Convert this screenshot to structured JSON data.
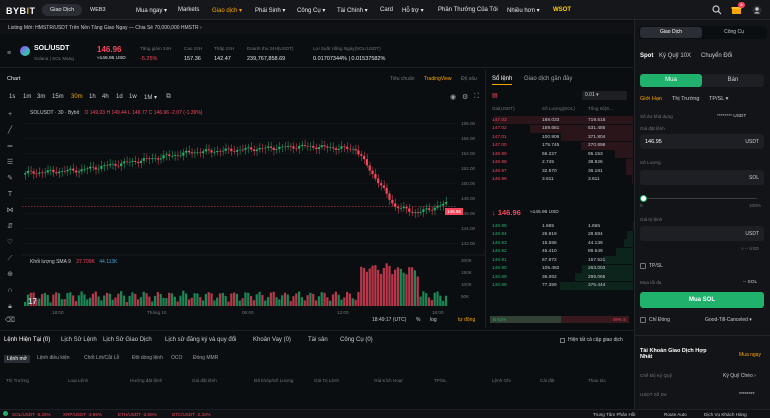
{
  "header": {
    "logo": "BYBIT",
    "seg_left": "Giao Dịch",
    "seg_right": "WEB3",
    "nav": [
      "Mua ngay ▾",
      "Markets",
      "Giao dịch ▾",
      "Phái Sinh ▾",
      "Công Cụ ▾",
      "Tài Chính ▾",
      "Card",
      "Hỗ trợ ▾",
      "Phần Thưởng Của Tôi",
      "Nhiều hơn ▾",
      "WSOT"
    ],
    "notif_count": "8"
  },
  "ticker": {
    "text": "Listing Mới: HMSTR/USDT Trên Nền Tảng Giao Ngay — Chia Sẻ 70,000,000 HMSTR  ›"
  },
  "symbol": {
    "pair": "SOL/USDT",
    "network": "Solana  |  SOL Mạng",
    "price": "146.96",
    "price_usd": "≈146.96 USD",
    "stats": [
      {
        "label": "Tăng giảm 24H",
        "value": "-5.25%",
        "cls": "red"
      },
      {
        "label": "Cao 24H",
        "value": "157.36",
        "cls": ""
      },
      {
        "label": "Thấp 24H",
        "value": "142.47",
        "cls": ""
      },
      {
        "label": "Doanh thu 24H(USDT)",
        "value": "239,767,858.69",
        "cls": ""
      },
      {
        "label": "Lợi Suất Hằng Ngày(SOL/USDT)",
        "value": "0.01707344% | 0.01537582%",
        "cls": "green"
      }
    ]
  },
  "chart": {
    "title": "Chart",
    "views": [
      "Tiêu chuẩn",
      "TradingView",
      "Độ sâu"
    ],
    "active_view": "TradingView",
    "intervals": [
      "1s",
      "1m",
      "3m",
      "15m",
      "30m",
      "1h",
      "4h",
      "1d",
      "1w",
      "1M ▾"
    ],
    "active_interval": "30m",
    "legend": "SOLUSDT · 30 · Bybit",
    "ohlc": "O 149.03  H 149.44  L 146.77  C 146.96  -2.07 (-1.39%)",
    "volume_label": "Khối lượng SMA 9",
    "volume_values": [
      "27.709K",
      "44.113K"
    ],
    "price_tag": "146.96",
    "x_ticks": [
      "18:00",
      "Tháng 10",
      "06:00",
      "12:00",
      "18:00"
    ],
    "time": "18:49:17 (UTC)",
    "scale_opts": [
      "%",
      "log",
      "tự động"
    ],
    "x_labels_bottom": "12:00"
  },
  "chart_data": {
    "type": "bar",
    "y_axis_ticks": [
      "158.00",
      "156.00",
      "154.00",
      "152.00",
      "150.00",
      "148.00",
      "146.00",
      "144.00",
      "142.00"
    ],
    "volume_ticks": [
      "200K",
      "150K",
      "100K",
      "50K"
    ],
    "ylim": [
      141,
      159
    ]
  },
  "orderbook": {
    "tabs": [
      "Sổ lệnh",
      "Giao dịch gần đây"
    ],
    "precision": "0.01",
    "cols": [
      "Giá(USDT)",
      "Số Lượng(SOL)",
      "Tổng số(S..."
    ],
    "asks": [
      [
        "147.03",
        "188.033",
        "719.518"
      ],
      [
        "147.02",
        "159.681",
        "531.485"
      ],
      [
        "147.01",
        "100.906",
        "371.804"
      ],
      [
        "147.00",
        "175.745",
        "270.898"
      ],
      [
        "146.99",
        "56.227",
        "95.153"
      ],
      [
        "146.98",
        "2.745",
        "38.926"
      ],
      [
        "146.97",
        "32.570",
        "36.181"
      ],
      [
        "146.96",
        "3.611",
        "3.611"
      ]
    ],
    "mid": "146.96",
    "mid_usd": "≈146.96 USD",
    "bids": [
      [
        "146.95",
        "1.665",
        "1.665"
      ],
      [
        "146.94",
        "26.919",
        "28.584"
      ],
      [
        "146.93",
        "15.555",
        "44.139"
      ],
      [
        "146.92",
        "45.410",
        "89.549"
      ],
      [
        "146.91",
        "67.972",
        "157.521"
      ],
      [
        "146.90",
        "105.482",
        "263.003"
      ],
      [
        "146.89",
        "36.062",
        "299.065"
      ],
      [
        "146.88",
        "77.359",
        "376.444"
      ]
    ],
    "buy_pct": "51%",
    "sell_pct": "49%",
    "buy_ratio": 0.51
  },
  "order": {
    "tabs": [
      "Giao Dịch",
      "Công Cụ"
    ],
    "mode_tabs": [
      "Spot",
      "Ký Quỹ 10X",
      "Chuyển Đổi"
    ],
    "side": [
      "Mua",
      "Bán"
    ],
    "types": [
      "Giới Hạn",
      "Thị Trường",
      "TP/SL ▾"
    ],
    "available_label": "Số dư khả dụng",
    "available_value": "******** USDT",
    "price_label": "Giá đặt lệnh",
    "price_value": "146.95",
    "price_unit": "USDT",
    "qty_label": "Số Lượng",
    "qty_unit": "SOL",
    "slider_pct": "0",
    "slider_max": "100%",
    "value_label": "Giá trị lệnh",
    "value_unit": "USDT",
    "value_approx": "≈ -- USD",
    "tpsl": "TP/SL",
    "max_buy_label": "Mua tối đa",
    "max_buy_value": "-- SOL",
    "submit": "Mua SOL",
    "post_only": "Chỉ Đóng",
    "tif": "Good-Till-Canceled ▾",
    "acct_title": "Tài Khoản Giao Dịch Hợp Nhất",
    "acct_action": "Mua ngay",
    "margin_label": "Chế Độ Ký Quỹ",
    "margin_value": "Ký Quỹ Chéo ›",
    "equity_label": "USDT Số Dư",
    "equity_value": "********"
  },
  "bottom": {
    "tabs": [
      "Lệnh Hiện Tại (0)",
      "Lịch Sử Lệnh",
      "Lịch Sử Giao Dịch",
      "Lịch sử đăng ký và quy đổi",
      "Khoản Vay (0)",
      "Tài sản",
      "Công Cụ (0)"
    ],
    "show_all": "Hiện tất cả cặp giao dịch",
    "subtabs": [
      "Lệnh mở",
      "Lệnh điều kiện",
      "Chốt Lời/Cắt Lỗ",
      "Đôi dòng lệnh",
      "OCO",
      "Đóng MMR"
    ],
    "cols": [
      "Thị Trường",
      "Loại Lệnh",
      "Hướng đặt lệnh",
      "Giá đặt lệnh",
      "Đã khớp/Số Lượng",
      "Giá Trị Lệnh",
      "Giá Kích Hoạt",
      "TP/SL",
      "Lệnh Ghi",
      "Cài đặt",
      "Thao tác"
    ]
  },
  "status": {
    "tickers": [
      "SOL/USDT -5.25%",
      "XRP/USDT -3.96%",
      "ETH/USDT -3.56%",
      "BTC/USDT -2.33%"
    ],
    "right": [
      "Trung Tâm Phản Hồi",
      "Route Auto",
      "Dịch Vụ Khách Hàng"
    ]
  },
  "colors": {
    "accent": "#f7a600",
    "green": "#20b26c",
    "red": "#f6465d"
  }
}
